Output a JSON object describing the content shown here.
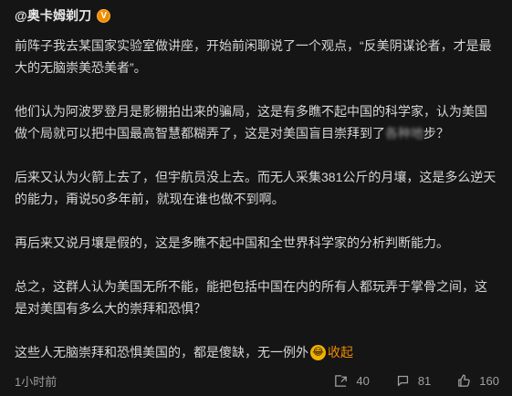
{
  "post": {
    "author_name": "@奥卡姆剃刀",
    "badge_symbol": "V",
    "paragraphs": [
      {
        "text": "前阵子我去某国家实验室做讲座，开始前闲聊说了一个观点，“反美阴谋论者，才是最大的无脑崇美恐美者”。"
      },
      {
        "text_before_blur": "他们认为阿波罗登月是影棚拍出来的骗局，这是有多瞧不起中国的科学家，认为美国做个局就可以把中国最高智慧都糊弄了，这是对美国盲目崇拜到了",
        "blurred_text": "各种地",
        "text_after_blur": "步？"
      },
      {
        "text": "后来又认为火箭上去了，但宇航员没上去。而无人采集381公斤的月壤，这是多么逆天的能力，甭说50多年前，就现在谁也做不到啊。"
      },
      {
        "text": "再后来又说月壤是假的，这是多瞧不起中国和全世界科学家的分析判断能力。"
      },
      {
        "text": "总之，这群人认为美国无所不能，能把包括中国在内的所有人都玩弄于掌骨之间，这是对美国有多么大的崇拜和恐惧？"
      },
      {
        "text": "这些人无脑崇拜和恐惧美国的，都是傻缺，无一例外",
        "emoji_name": "laughing-emoji",
        "emoji_symbol": "😂",
        "collapse_label": "收起"
      }
    ],
    "timestamp": "1小时前",
    "actions": [
      {
        "icon": "share-icon",
        "count": "40"
      },
      {
        "icon": "comment-icon",
        "count": "81"
      },
      {
        "icon": "like-icon",
        "count": "160"
      }
    ]
  },
  "colors": {
    "background": "#151515",
    "text": "#d6d6d6",
    "muted": "#9b9b9b",
    "accent": "#f08c00"
  }
}
